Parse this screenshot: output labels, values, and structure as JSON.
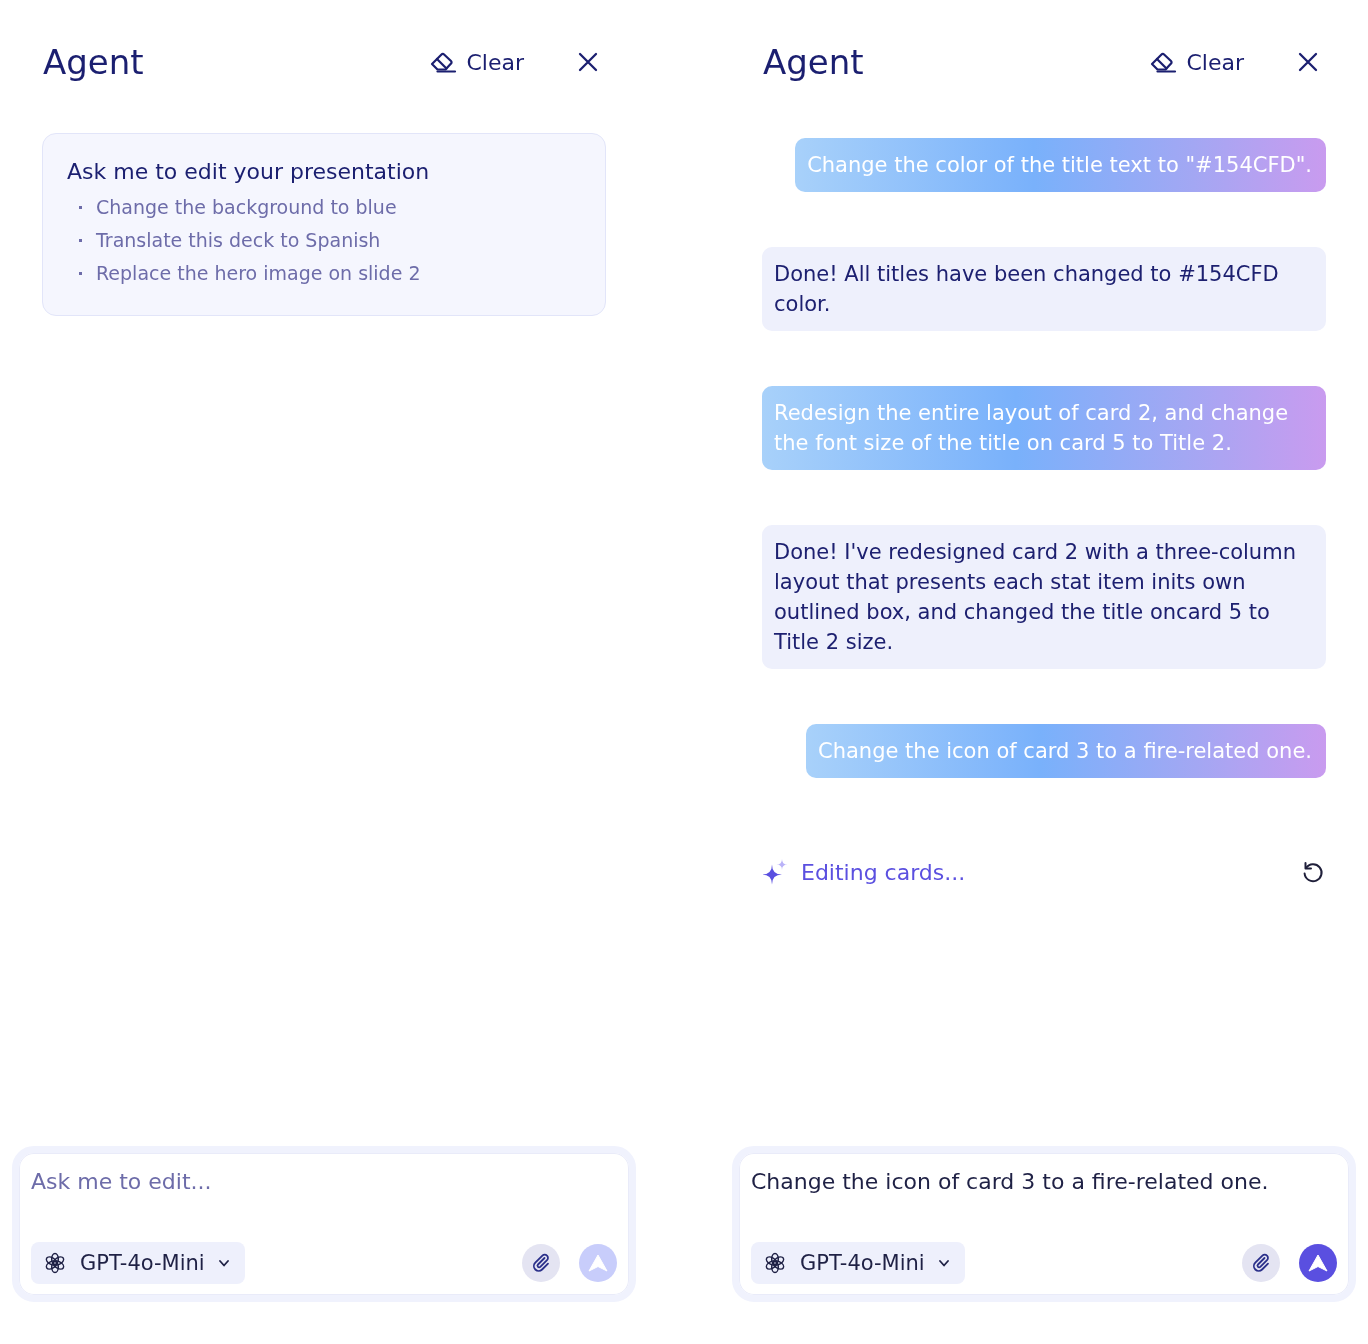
{
  "panels": [
    {
      "title": "Agent",
      "clear_button": {
        "label": "Clear"
      },
      "intro_card": {
        "title": "Ask me to edit your presentation",
        "suggestions": [
          "Change the background to blue",
          "Translate this deck to Spanish",
          "Replace the hero image on slide 2"
        ]
      },
      "composer": {
        "placeholder": "Ask me to edit...",
        "model": "GPT-4o-Mini",
        "send_button": {
          "disabled": true
        }
      }
    },
    {
      "title": "Agent",
      "clear_button": {
        "label": "Clear"
      },
      "messages": [
        {
          "kind": "user",
          "text": "Change the color of the title text to \"#154CFD\"."
        },
        {
          "kind": "assistant",
          "text": "Done! All titles have been changed to #154CFD color."
        },
        {
          "kind": "user",
          "text": "Redesign the entire layout of card 2, and change the font size of the title on card 5 to Title 2."
        },
        {
          "kind": "assistant",
          "text": "Done! I've redesigned card 2 with a three-column layout that presents each stat item inits own outlined box, and changed the title oncard 5 to Title 2 size."
        },
        {
          "kind": "user",
          "text": "Change the icon of card 3 to a fire-related one."
        }
      ],
      "status": {
        "text": "Editing cards..."
      },
      "composer": {
        "value": "Change the icon of card 3 to a fire-related one.",
        "model": "GPT-4o-Mini",
        "send_button": {
          "disabled": false
        }
      }
    }
  ]
}
